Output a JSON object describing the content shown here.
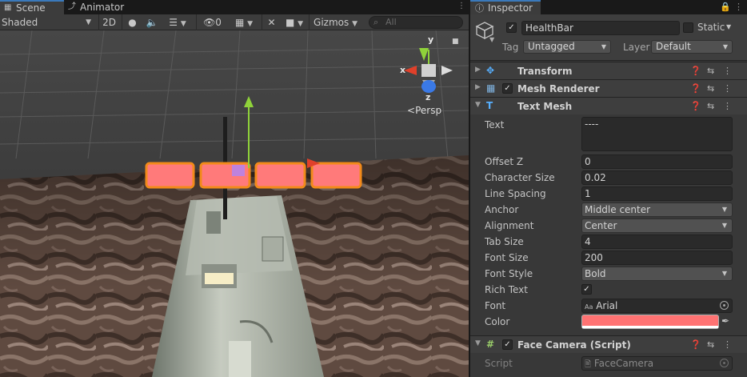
{
  "scene_tabs": {
    "scene": "Scene",
    "animator": "Animator"
  },
  "scene_toolbar": {
    "draw_mode": "Shaded",
    "mode_2d": "2D",
    "hidden_count": "0",
    "gizmos": "Gizmos",
    "search_placeholder": "All"
  },
  "gizmo": {
    "x": "x",
    "y": "y",
    "z": "z",
    "projection": "Persp"
  },
  "inspector": {
    "tab": "Inspector",
    "object_name": "HealthBar",
    "active": true,
    "static_label": "Static",
    "tag_label": "Tag",
    "tag_value": "Untagged",
    "layer_label": "Layer",
    "layer_value": "Default"
  },
  "components": {
    "transform": "Transform",
    "mesh_renderer": "Mesh Renderer",
    "text_mesh": "Text Mesh",
    "face_camera": "Face Camera (Script)"
  },
  "text_mesh_props": {
    "text_label": "Text",
    "text_value": "----",
    "offset_z_label": "Offset Z",
    "offset_z": "0",
    "char_size_label": "Character Size",
    "char_size": "0.02",
    "line_spacing_label": "Line Spacing",
    "line_spacing": "1",
    "anchor_label": "Anchor",
    "anchor": "Middle center",
    "alignment_label": "Alignment",
    "alignment": "Center",
    "tab_size_label": "Tab Size",
    "tab_size": "4",
    "font_size_label": "Font Size",
    "font_size": "200",
    "font_style_label": "Font Style",
    "font_style": "Bold",
    "rich_text_label": "Rich Text",
    "rich_text": true,
    "font_label": "Font",
    "font_value": "Arial",
    "color_label": "Color",
    "color_value": "#ff7373"
  },
  "face_camera_props": {
    "script_label": "Script",
    "script_value": "FaceCamera"
  },
  "colors": {
    "accent": "#3a79bb",
    "health_segment": "#ff7a7a",
    "selection_outline": "#f28a1a",
    "gizmo_y": "#8fd23a",
    "gizmo_x": "#e0402a",
    "gizmo_z": "#3a79e6"
  }
}
